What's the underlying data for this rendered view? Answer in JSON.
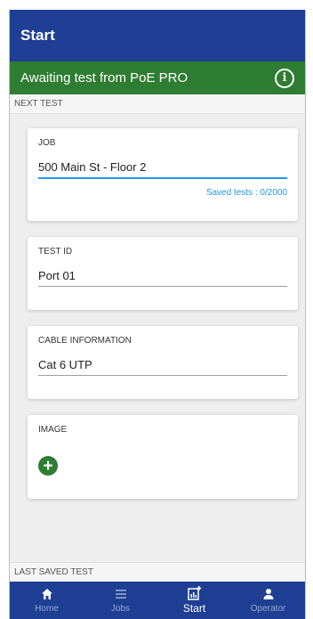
{
  "app_bar": {
    "title": "Start"
  },
  "status_bar": {
    "message": "Awaiting test from PoE PRO",
    "info_icon": "i"
  },
  "next_test": {
    "label": "NEXT TEST",
    "job": {
      "label": "JOB",
      "value": "500 Main St - Floor 2",
      "saved_tests": "Saved tests : 0/2000"
    },
    "test_id": {
      "label": "TEST ID",
      "value": "Port 01"
    },
    "cable": {
      "label": "CABLE INFORMATION",
      "value": "Cat 6 UTP"
    },
    "image": {
      "label": "IMAGE",
      "add_icon": "+"
    }
  },
  "last_saved": {
    "label": "LAST SAVED TEST"
  },
  "nav": {
    "items": [
      {
        "label": "Home",
        "icon": "home-icon"
      },
      {
        "label": "Jobs",
        "icon": "list-icon"
      },
      {
        "label": "Start",
        "icon": "chart-add-icon",
        "active": true
      },
      {
        "label": "Operator",
        "icon": "person-icon"
      }
    ]
  },
  "colors": {
    "primary": "#1f3f94",
    "status_green": "#2e7d32",
    "accent": "#2196f3"
  }
}
